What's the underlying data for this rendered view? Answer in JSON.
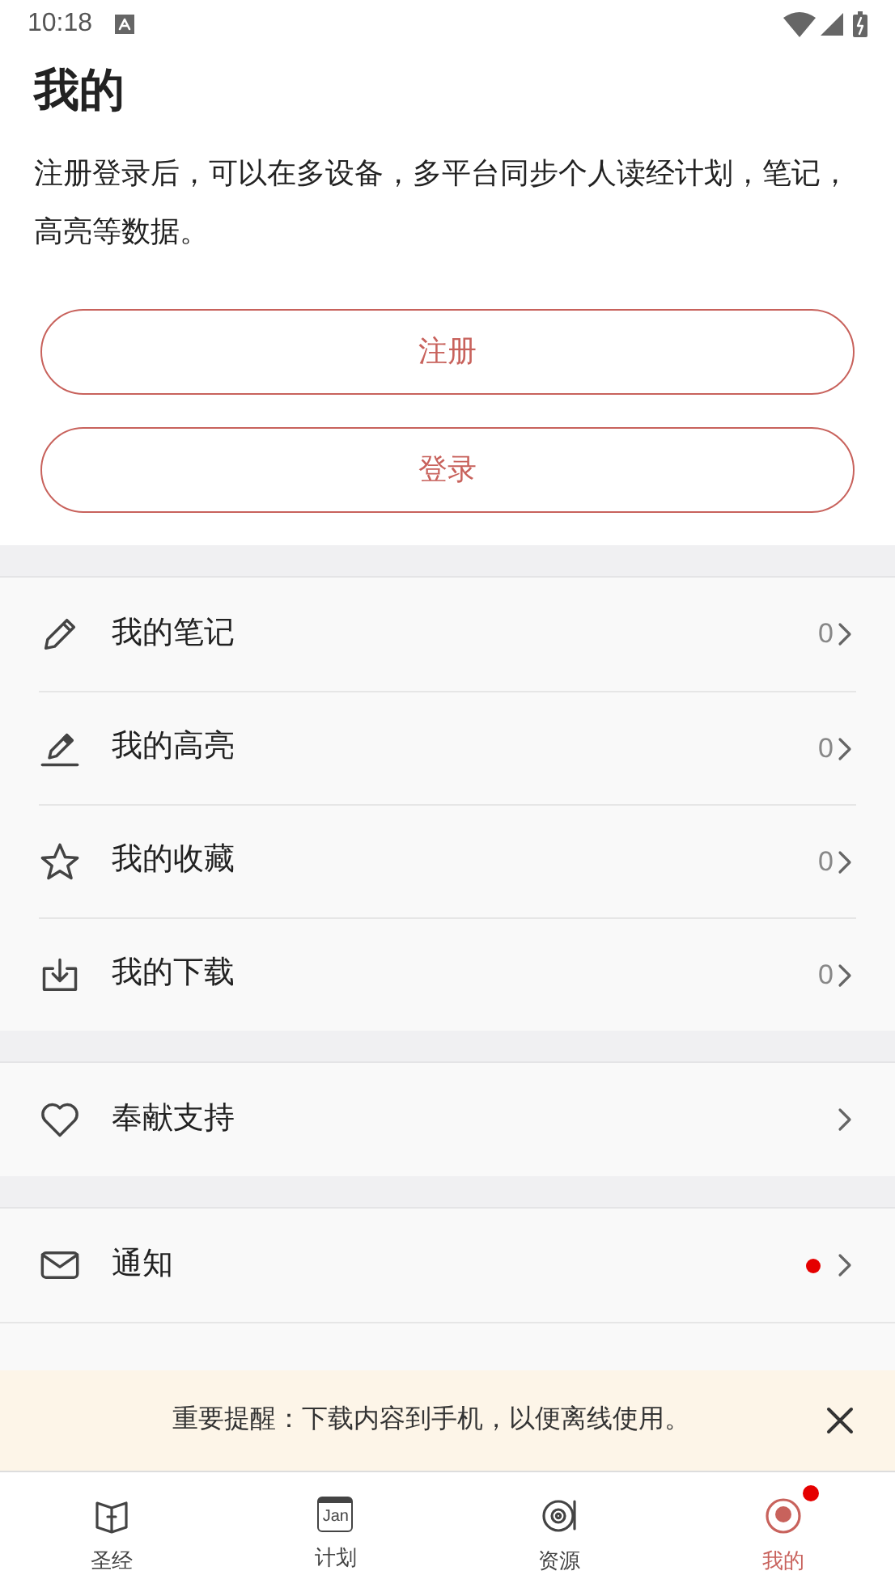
{
  "status_bar": {
    "time": "10:18"
  },
  "title": "我的",
  "intro": "注册登录后，可以在多设备，多平台同步个人读经计划，笔记，高亮等数据。",
  "buttons": [
    "注册",
    "登录"
  ],
  "sections": [
    {
      "items": [
        {
          "kind": "note",
          "label": "我的笔记",
          "count": "0"
        },
        {
          "kind": "highlight",
          "label": "我的高亮",
          "count": "0"
        },
        {
          "kind": "favorite",
          "label": "我的收藏",
          "count": "0"
        },
        {
          "kind": "download",
          "label": "我的下载",
          "count": "0"
        }
      ]
    },
    {
      "items": [
        {
          "kind": "support",
          "label": "奉献支持"
        }
      ]
    },
    {
      "items": [
        {
          "kind": "notice",
          "label": "通知",
          "unread": true
        }
      ]
    }
  ],
  "banner": {
    "text": "重要提醒：下载内容到手机，以便离线使用。"
  },
  "nav": [
    {
      "kind": "bible",
      "label": "圣经",
      "selected": false,
      "badge": false
    },
    {
      "kind": "plan",
      "label": "计划",
      "selected": false,
      "badge": false,
      "icon_text": "Jan"
    },
    {
      "kind": "resources",
      "label": "资源",
      "selected": false,
      "badge": false
    },
    {
      "kind": "me",
      "label": "我的",
      "selected": true,
      "badge": true
    }
  ]
}
